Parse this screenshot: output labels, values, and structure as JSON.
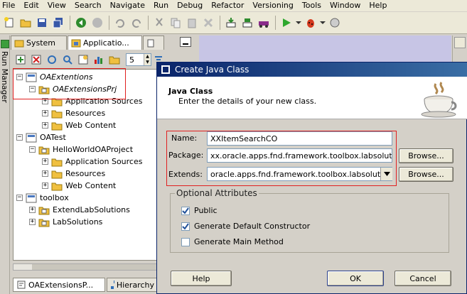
{
  "menubar": {
    "items": [
      "File",
      "Edit",
      "View",
      "Search",
      "Navigate",
      "Run",
      "Debug",
      "Refactor",
      "Versioning",
      "Tools",
      "Window",
      "Help"
    ]
  },
  "navigator": {
    "tabs": [
      "System",
      "Applicatio...",
      ""
    ],
    "depth_value": "5",
    "tree": [
      {
        "label": "OAExtentions",
        "indent": 0,
        "italic": true
      },
      {
        "label": "OAExtensionsPrj",
        "indent": 1,
        "italic": true
      },
      {
        "label": "Application Sources",
        "indent": 2
      },
      {
        "label": "Resources",
        "indent": 2
      },
      {
        "label": "Web Content",
        "indent": 2
      },
      {
        "label": "OATest",
        "indent": 0
      },
      {
        "label": "HelloWorldOAProject",
        "indent": 1
      },
      {
        "label": "Application Sources",
        "indent": 2
      },
      {
        "label": "Resources",
        "indent": 2
      },
      {
        "label": "Web Content",
        "indent": 2
      },
      {
        "label": "toolbox",
        "indent": 0
      },
      {
        "label": "ExtendLabSolutions",
        "indent": 1
      },
      {
        "label": "LabSolutions",
        "indent": 1
      }
    ],
    "bottom_tabs": [
      "OAExtensionsP...",
      "Hierarchy"
    ]
  },
  "left_strip": {
    "label": "Run Manager"
  },
  "dialog": {
    "title": "Create Java Class",
    "header_title": "Java Class",
    "header_desc": "Enter the details of your new class.",
    "name_label": "Name:",
    "name_value": "XXItemSearchCO",
    "package_label": "Package:",
    "package_value": "xx.oracle.apps.fnd.framework.toolbox.labsolut",
    "extends_label": "Extends:",
    "extends_value": "oracle.apps.fnd.framework.toolbox.labsoluti",
    "browse_label": "Browse...",
    "optional_title": "Optional Attributes",
    "opt_public": "Public",
    "opt_constructor": "Generate Default Constructor",
    "opt_main": "Generate Main Method",
    "help_label": "Help",
    "ok_label": "OK",
    "cancel_label": "Cancel",
    "checks": {
      "public": true,
      "constructor": true,
      "main": false
    }
  },
  "colors": {
    "highlight": "#e02020",
    "editor_bg": "#c7c5e5",
    "title_start": "#0a246a",
    "title_end": "#3a6ea5"
  }
}
